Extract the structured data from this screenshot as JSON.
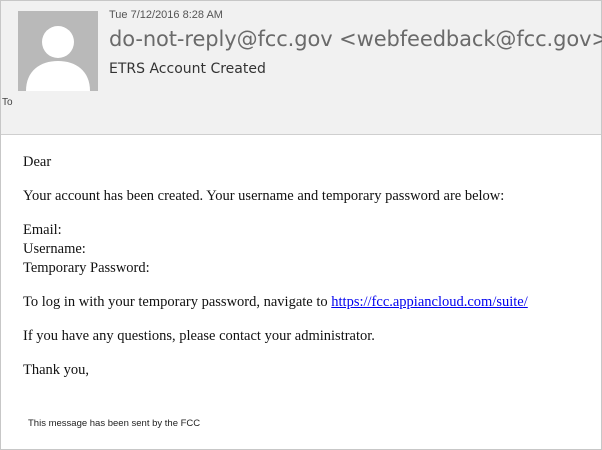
{
  "header": {
    "date": "Tue 7/12/2016 8:28 AM",
    "sender": "do-not-reply@fcc.gov <webfeedback@fcc.gov>",
    "subject": "ETRS Account Created",
    "to_label": "To"
  },
  "body": {
    "greeting": "Dear",
    "line1": "Your account has been created. Your username and temporary password are below:",
    "email_label": "Email:",
    "username_label": "Username:",
    "password_label": "Temporary Password:",
    "login_text": "To log in with your temporary password, navigate to ",
    "login_link": "https://fcc.appiancloud.com/suite/",
    "questions": "If you have any questions, please contact your administrator.",
    "thanks": "Thank you,",
    "footer": "This message has been sent by the FCC"
  },
  "colors": {
    "header_bg": "#f1f1f1",
    "link": "#0000ee"
  }
}
